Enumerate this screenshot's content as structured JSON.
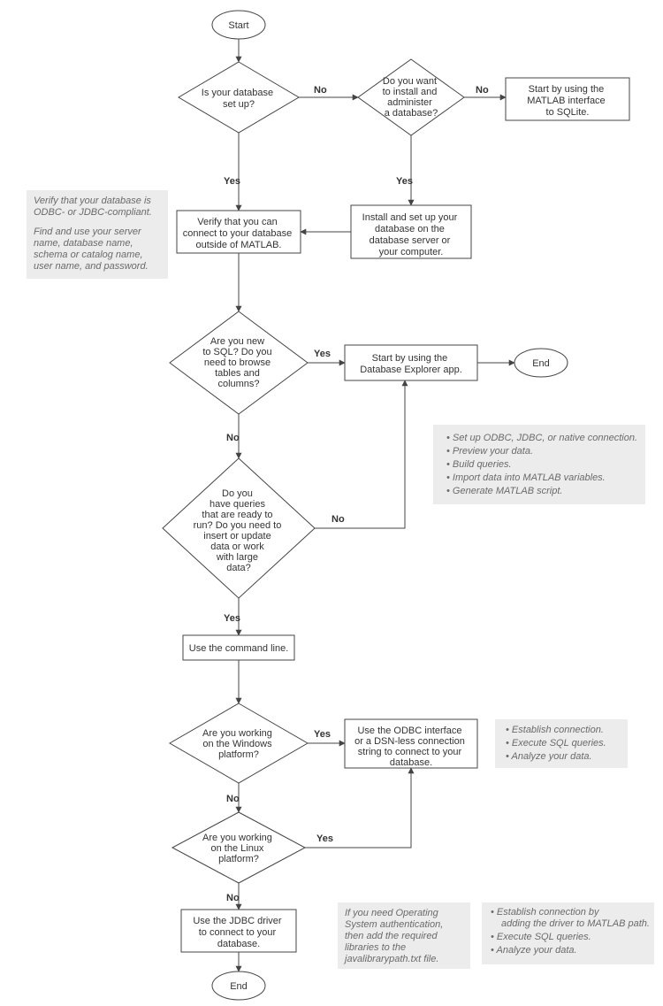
{
  "terminals": {
    "start": "Start",
    "end_db_explorer": "End",
    "end_final": "End"
  },
  "decisions": {
    "d1": {
      "l1": "Is your database",
      "l2": "set up?"
    },
    "d2": {
      "l1": "Do you want",
      "l2": "to install and",
      "l3": "administer",
      "l4": "a database?"
    },
    "d3": {
      "l1": "Are you new",
      "l2": "to SQL? Do you",
      "l3": "need to browse",
      "l4": "tables and",
      "l5": "columns?"
    },
    "d4": {
      "l1": "Do you",
      "l2": "have queries",
      "l3": "that are ready to",
      "l4": "run? Do you need to",
      "l5": "insert or update",
      "l6": "data or work",
      "l7": "with large",
      "l8": "data?"
    },
    "d5": {
      "l1": "Are you working",
      "l2": "on the Windows",
      "l3": "platform?"
    },
    "d6": {
      "l1": "Are you working",
      "l2": "on the Linux",
      "l3": "platform?"
    }
  },
  "processes": {
    "p_sqlite": {
      "l1": "Start by using the",
      "l2": "MATLAB interface",
      "l3": "to SQLite."
    },
    "p_install": {
      "l1": "Install and set up your",
      "l2": "database on the",
      "l3": "database server or",
      "l4": "your computer."
    },
    "p_verify": {
      "l1": "Verify that you can",
      "l2": "connect to your database",
      "l3": "outside of MATLAB."
    },
    "p_explorer": {
      "l1": "Start by using the",
      "l2": "Database Explorer app."
    },
    "p_cmdline": {
      "l1": "Use the command line."
    },
    "p_odbc": {
      "l1": "Use the ODBC interface",
      "l2": "or a DSN-less connection",
      "l3": "string to connect to your",
      "l4": "database."
    },
    "p_jdbc": {
      "l1": "Use the JDBC driver",
      "l2": "to connect to your",
      "l3": "database."
    }
  },
  "labels": {
    "yes": "Yes",
    "no": "No"
  },
  "notes": {
    "note_verify": {
      "l1": "Verify that your database is",
      "l2": "ODBC- or JDBC-compliant.",
      "l3": "Find and use your server",
      "l4": "name, database name,",
      "l5": "schema or catalog name,",
      "l6": "user name, and password."
    },
    "note_explorer": {
      "b1": "Set up ODBC, JDBC, or native connection.",
      "b2": "Preview your data.",
      "b3": "Build queries.",
      "b4": "Import data into MATLAB variables.",
      "b5": "Generate MATLAB script."
    },
    "note_odbc": {
      "b1": "Establish connection.",
      "b2": "Execute SQL queries.",
      "b3": "Analyze your data."
    },
    "note_os": {
      "l1": "If you need Operating",
      "l2": "System authentication,",
      "l3": "then add the required",
      "l4": "libraries to the",
      "l5": "javalibrarypath.txt file."
    },
    "note_jdbc": {
      "b1": "Establish connection by",
      "b1b": "adding the driver to MATLAB path.",
      "b2": "Execute SQL queries.",
      "b3": "Analyze your data."
    }
  }
}
